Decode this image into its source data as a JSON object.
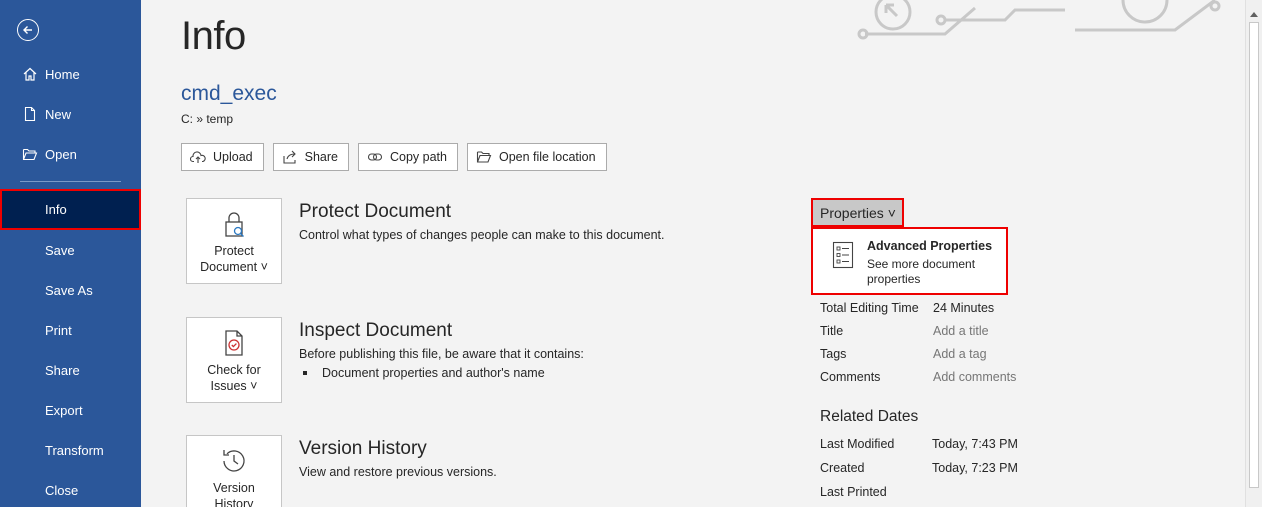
{
  "sidebar": {
    "items": [
      {
        "label": "Home",
        "icon": "home-icon"
      },
      {
        "label": "New",
        "icon": "new-document-icon"
      },
      {
        "label": "Open",
        "icon": "folder-open-icon"
      },
      {
        "label": "Info"
      },
      {
        "label": "Save"
      },
      {
        "label": "Save As"
      },
      {
        "label": "Print"
      },
      {
        "label": "Share"
      },
      {
        "label": "Export"
      },
      {
        "label": "Transform"
      },
      {
        "label": "Close"
      }
    ]
  },
  "main": {
    "title": "Info",
    "doc_name": "cmd_exec",
    "doc_path": "C: » temp",
    "actions": [
      {
        "label": "Upload",
        "icon": "upload-icon"
      },
      {
        "label": "Share",
        "icon": "share-icon"
      },
      {
        "label": "Copy path",
        "icon": "link-icon"
      },
      {
        "label": "Open file location",
        "icon": "folder-icon"
      }
    ],
    "sections": [
      {
        "tile_line1": "Protect",
        "tile_line2": "Document ˅",
        "title": "Protect Document",
        "desc": "Control what types of changes people can make to this document."
      },
      {
        "tile_line1": "Check for",
        "tile_line2": "Issues ˅",
        "title": "Inspect Document",
        "desc": "Before publishing this file, be aware that it contains:",
        "bullet": "Document properties and author's name"
      },
      {
        "tile_line1": "Version",
        "tile_line2": "History",
        "title": "Version History",
        "desc": "View and restore previous versions."
      }
    ]
  },
  "properties": {
    "button_label": "Properties ˅",
    "advanced_title": "Advanced Properties",
    "advanced_desc": "See more document properties",
    "rows": [
      {
        "key": "Total Editing Time",
        "value": "24 Minutes"
      },
      {
        "key": "Title",
        "value": "Add a title"
      },
      {
        "key": "Tags",
        "value": "Add a tag"
      },
      {
        "key": "Comments",
        "value": "Add comments"
      }
    ],
    "related_title": "Related Dates",
    "dates": [
      {
        "key": "Last Modified",
        "value": "Today, 7:43 PM"
      },
      {
        "key": "Created",
        "value": "Today, 7:23 PM"
      },
      {
        "key": "Last Printed",
        "value": ""
      }
    ]
  },
  "colors": {
    "sidebar": "#2b579a",
    "active": "#002050",
    "highlight": "#ee0000",
    "link": "#2b579a"
  }
}
